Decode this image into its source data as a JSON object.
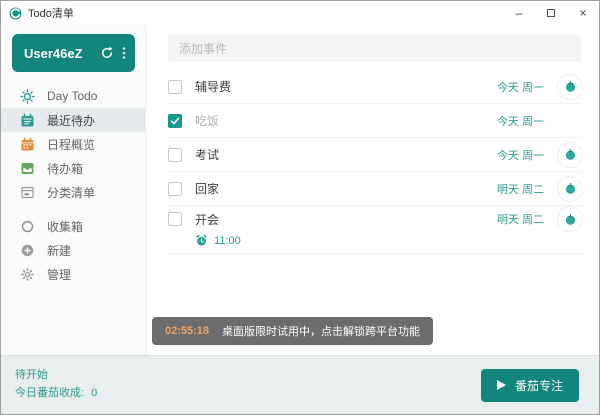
{
  "window": {
    "title": "Todo清单",
    "controls": {
      "minimize": "–",
      "close": "×"
    }
  },
  "sidebar": {
    "user": {
      "name": "User46eZ"
    },
    "nav": [
      {
        "label": "Day Todo"
      },
      {
        "label": "最近待办"
      },
      {
        "label": "日程概览"
      },
      {
        "label": "待办箱"
      },
      {
        "label": "分类清单"
      }
    ],
    "nav_secondary": [
      {
        "label": "收集箱"
      },
      {
        "label": "新建"
      },
      {
        "label": "管理"
      }
    ]
  },
  "main": {
    "add_input_placeholder": "添加事件",
    "todos": [
      {
        "title": "辅导费",
        "date": "今天 周一",
        "checked": false
      },
      {
        "title": "吃饭",
        "date": "今天 周一",
        "checked": true
      },
      {
        "title": "考试",
        "date": "今天 周一",
        "checked": false
      },
      {
        "title": "回家",
        "date": "明天 周二",
        "checked": false
      },
      {
        "title": "开会",
        "date": "明天 周二",
        "checked": false,
        "alarm": "11:00"
      }
    ],
    "toast": {
      "time": "02:55:18",
      "message": "桌面版限时试用中，点击解锁跨平台功能"
    }
  },
  "footer": {
    "status": "待开始",
    "harvest_label": "今日番茄收成:",
    "harvest_count": "0",
    "focus_button": "番茄专注"
  },
  "colors": {
    "primary_teal": "#12857c",
    "date_teal": "#2f9e94",
    "selected_nav_bg": "#e7ebee",
    "footer_bg": "#e8efee",
    "toast_bg": "#6c6c6c",
    "toast_time": "#e9a66d",
    "calendar_orange": "#e58a3a",
    "inbox_green": "#67a85c"
  }
}
